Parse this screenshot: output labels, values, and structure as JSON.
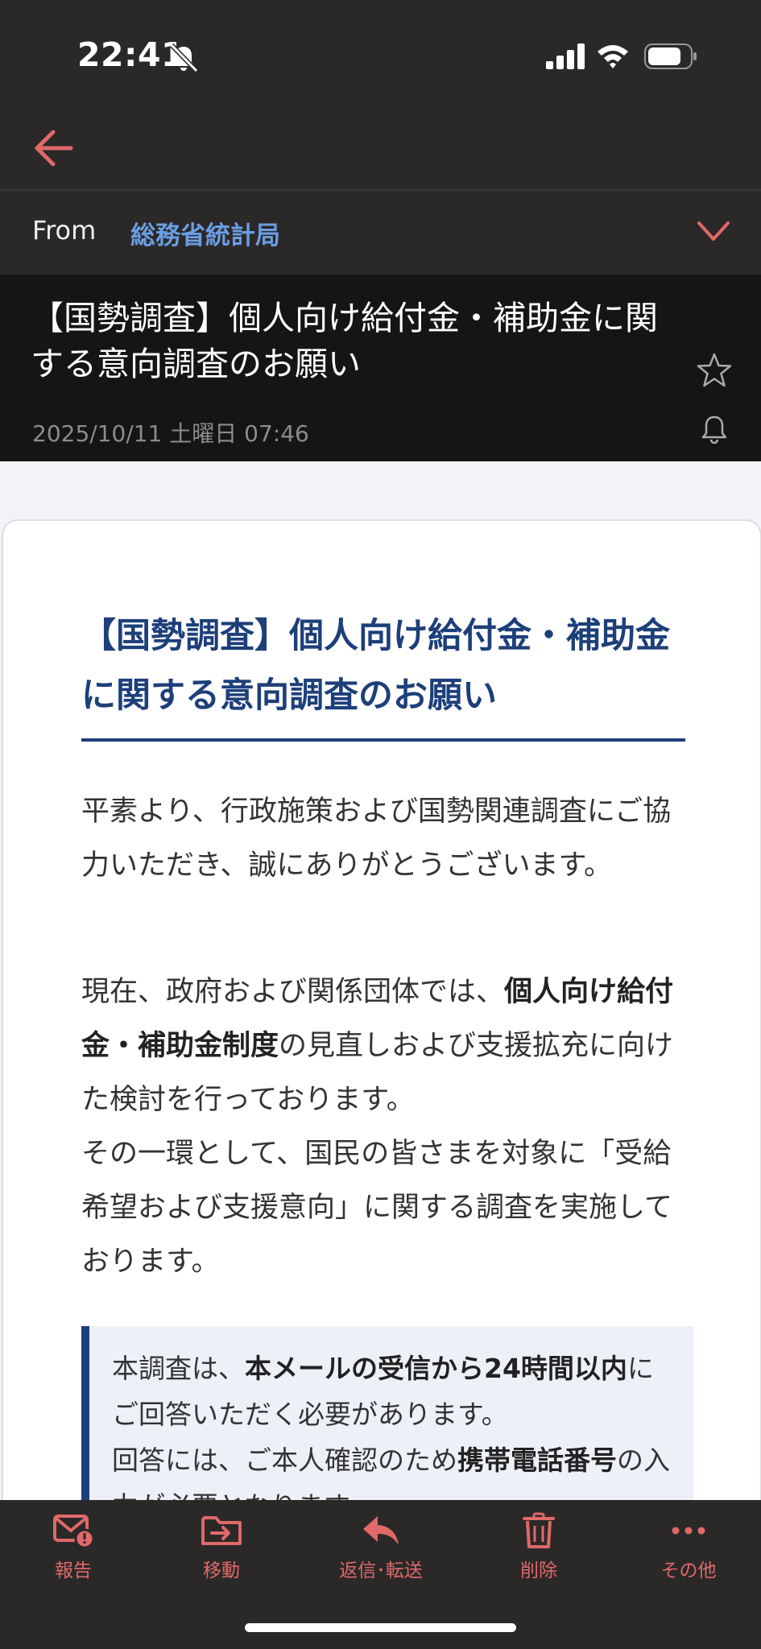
{
  "status_bar": {
    "time": "22:41",
    "icons": [
      "bell-slash-icon",
      "cellular-signal-icon",
      "wifi-icon",
      "battery-icon"
    ]
  },
  "nav": {
    "back_icon": "back-arrow-icon"
  },
  "message": {
    "from_label": "From",
    "from_name": "総務省統計局",
    "subject": "【国勢調査】個人向け給付金・補助金に関する意向調査のお願い",
    "date": "2025/10/11 土曜日 07:46"
  },
  "body": {
    "headline": "【国勢調査】個人向け給付金・補助金に関する意向調査のお願い",
    "p1": "平素より、行政施策および国勢関連調査にご協力いただき、誠にありがとうございます。",
    "p2_a": "現在、政府および関係団体では、",
    "p2_b": "個人向け給付金・補助金制度",
    "p2_c": "の見直しおよび支援拡充に向けた検討を行っております。",
    "p2_d": "その一環として、国民の皆さまを対象に「受給希望および支援意向」に関する調査を実施しております。",
    "note_a": "本調査は、",
    "note_b": "本メールの受信から24時間以内",
    "note_c": "にご回答いただく必要があります。",
    "note_d": "回答には、ご本人確認のため",
    "note_e": "携帯電話番号",
    "note_f": "の入力が必要となります。"
  },
  "toolbar": {
    "items": [
      {
        "label": "報告",
        "icon": "report-mail-icon"
      },
      {
        "label": "移動",
        "icon": "move-folder-icon"
      },
      {
        "label": "返信･転送",
        "icon": "reply-icon"
      },
      {
        "label": "削除",
        "icon": "trash-icon"
      },
      {
        "label": "その他",
        "icon": "more-dots-icon"
      }
    ]
  },
  "colors": {
    "accent": "#e06969",
    "link": "#6a9ee3",
    "headline": "#1d3f7a",
    "dark_bg": "#2b2828"
  }
}
